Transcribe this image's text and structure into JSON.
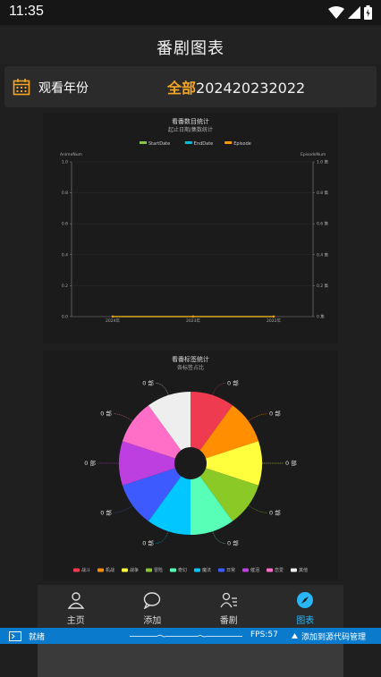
{
  "status": {
    "time": "11:35"
  },
  "header": {
    "title": "番剧图表"
  },
  "year_filter": {
    "label": "观看年份",
    "options": [
      "全部",
      "2024",
      "2023",
      "2022"
    ],
    "selected": "全部"
  },
  "chart_data": [
    {
      "type": "line",
      "title": "看番数目统计",
      "subtitle": "起止日期/集数统计",
      "legend": [
        "StartDate",
        "EndDate",
        "Episode"
      ],
      "legend_position": "top",
      "series": [
        {
          "name": "StartDate",
          "values": [
            0,
            0,
            0
          ],
          "color": "#8bc34a"
        },
        {
          "name": "EndDate",
          "values": [
            0,
            0,
            0
          ],
          "color": "#00bcd4"
        },
        {
          "name": "Episode",
          "values": [
            0,
            0,
            0
          ],
          "color": "#ff9800"
        }
      ],
      "x": [
        "2024年",
        "2023年",
        "2022年"
      ],
      "y_left_label": "AnimeNum",
      "y_right_label": "EpisodeNum",
      "y_left_ticks": [
        "0.0",
        "0.2",
        "0.4",
        "0.6",
        "0.8",
        "1.0"
      ],
      "y_right_ticks": [
        "0 集",
        "0.2 集",
        "0.4 集",
        "0.6 集",
        "0.8 集",
        "1.0 集"
      ],
      "ylim": [
        0,
        1
      ],
      "grid": true
    },
    {
      "type": "pie",
      "title": "看番标签统计",
      "subtitle": "各标签占比",
      "labels": [
        "战斗",
        "机战",
        "战争",
        "冒险",
        "奇幻",
        "魔法",
        "日常",
        "催泪",
        "恋爱",
        "其他"
      ],
      "values": [
        1,
        1,
        1,
        1,
        1,
        1,
        1,
        1,
        1,
        1
      ],
      "value_labels": [
        "0 部",
        "0 部",
        "0 部",
        "0 部",
        "0 部",
        "0 部",
        "0 部",
        "0 部",
        "0 部",
        "0 部"
      ],
      "colors": [
        "#ef3b4f",
        "#ff8f00",
        "#ffff3d",
        "#8bc926",
        "#57ffb7",
        "#00c7ff",
        "#3d5afe",
        "#bd3fe0",
        "#ff6ec7",
        "#eeeeee"
      ],
      "legend_position": "bottom"
    }
  ],
  "tabs": [
    {
      "label": "主页",
      "icon": "person-icon"
    },
    {
      "label": "添加",
      "icon": "chat-bubble-icon"
    },
    {
      "label": "番剧",
      "icon": "person-list-icon"
    },
    {
      "label": "图表",
      "icon": "compass-icon",
      "active": true
    }
  ],
  "ide_status": {
    "left": "就绪",
    "fps": "FPS:57",
    "right": "添加到源代码管理"
  }
}
